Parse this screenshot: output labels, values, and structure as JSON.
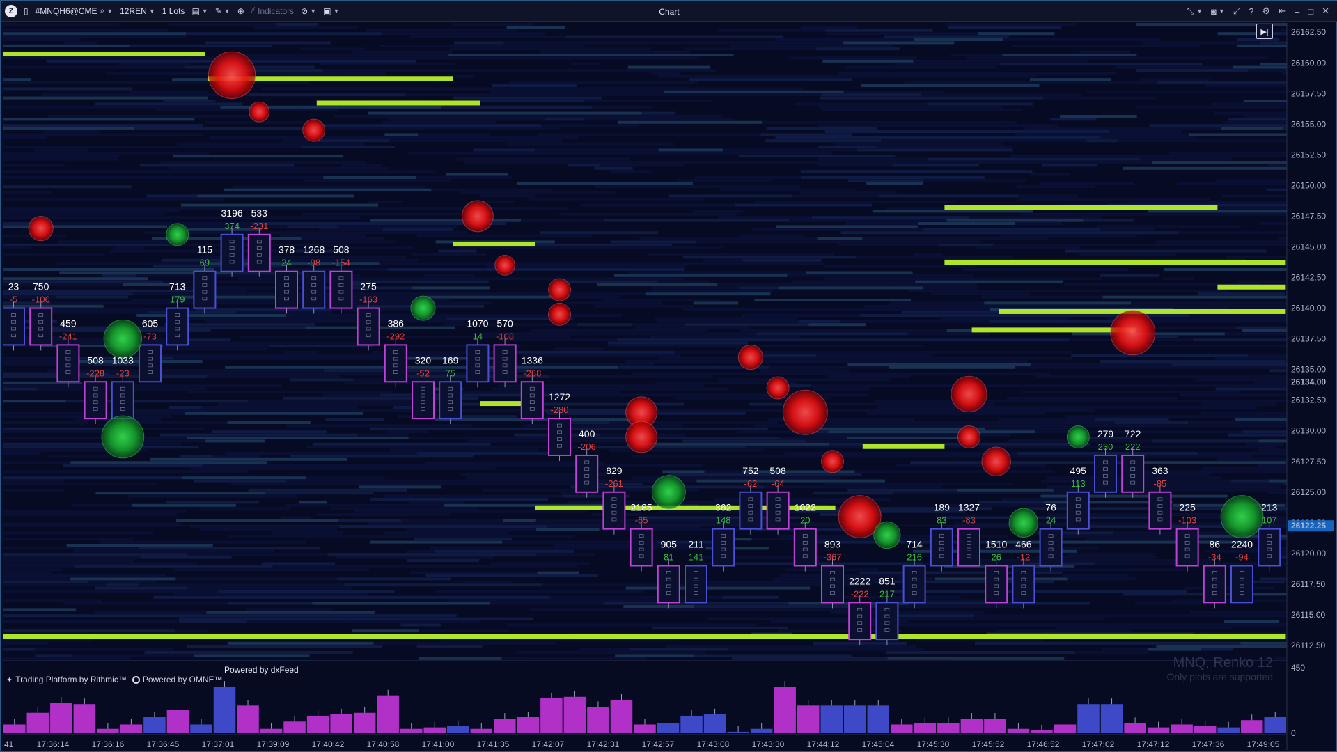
{
  "titlebar": {
    "symbol": "#MNQH6@CME",
    "bar_type": "12REN",
    "lots": "1 Lots",
    "indicators": "Indicators",
    "window_title": "Chart"
  },
  "price_axis": {
    "labels": [
      "26162.50",
      "26160.00",
      "26157.50",
      "26155.00",
      "26152.50",
      "26150.00",
      "26147.50",
      "26145.00",
      "26142.50",
      "26140.00",
      "26137.50",
      "26135.00",
      "26132.50",
      "26130.00",
      "26127.50",
      "26125.00",
      "26122.50",
      "26120.00",
      "26117.50",
      "26115.00",
      "26112.50"
    ],
    "last_price": "26134.00",
    "current_price": "26122.25",
    "volume_max": "450",
    "volume_zero": "0"
  },
  "time_axis": [
    "17:36:14",
    "17:36:16",
    "17:36:45",
    "17:37:01",
    "17:39:09",
    "17:40:42",
    "17:40:58",
    "17:41:00",
    "17:41:35",
    "17:42:07",
    "17:42:31",
    "17:42:57",
    "17:43:08",
    "17:43:30",
    "17:44:12",
    "17:45:04",
    "17:45:30",
    "17:45:52",
    "17:46:52",
    "17:47:02",
    "17:47:12",
    "17:47:36",
    "17:49:05"
  ],
  "time_axis_partial": "41",
  "overlay": {
    "platform_text": "Trading Platform by Rithmic™",
    "omne_text": "Powered by OMNE™",
    "dxfeed_text": "Powered by dxFeed",
    "watermark_title": "MNQ, Renko 12",
    "watermark_sub": "Only plots are supported"
  },
  "chart_data": {
    "type": "renko-footprint",
    "price_range": [
      26111.25,
      26163.25
    ],
    "bricks": [
      {
        "o": 26137.0,
        "c": 26140.0,
        "vol": "23",
        "delta": "-5",
        "d": "r"
      },
      {
        "o": 26140.0,
        "c": 26137.0,
        "vol": "750",
        "delta": "-106",
        "d": "r",
        "b": 26141.5
      },
      {
        "o": 26137.0,
        "c": 26134.0,
        "vol": "459",
        "delta": "-241",
        "d": "r"
      },
      {
        "o": 26134.0,
        "c": 26131.0,
        "vol": "508",
        "delta": "-228",
        "d": "r"
      },
      {
        "o": 26131.0,
        "c": 26134.0,
        "vol": "1033",
        "delta": "-23",
        "d": "g",
        "b": 26127.5
      },
      {
        "o": 26134.0,
        "c": 26137.0,
        "vol": "605",
        "delta": "-73",
        "d": "r"
      },
      {
        "o": 26137.0,
        "c": 26140.0,
        "vol": "713",
        "delta": "179",
        "d": "g",
        "b": 26140.0
      },
      {
        "o": 26140.0,
        "c": 26143.0,
        "vol": "115",
        "delta": "69",
        "d": "g"
      },
      {
        "o": 26143.0,
        "c": 26146.0,
        "vol": "3196",
        "delta": "374",
        "d": "g",
        "b": 26148.0
      },
      {
        "o": 26146.0,
        "c": 26143.0,
        "vol": "533",
        "delta": "-231",
        "d": "r"
      },
      {
        "o": 26143.0,
        "c": 26140.0,
        "vol": "378",
        "delta": "24",
        "d": "g"
      },
      {
        "o": 26140.0,
        "c": 26143.0,
        "vol": "1268",
        "delta": "-98",
        "d": "r",
        "b": 26144.0
      },
      {
        "o": 26143.0,
        "c": 26140.0,
        "vol": "508",
        "delta": "-154",
        "d": "r"
      },
      {
        "o": 26140.0,
        "c": 26137.0,
        "vol": "275",
        "delta": "-163",
        "d": "r"
      },
      {
        "o": 26137.0,
        "c": 26134.0,
        "vol": "386",
        "delta": "-292",
        "d": "r"
      },
      {
        "o": 26134.0,
        "c": 26131.0,
        "vol": "320",
        "delta": "-52",
        "d": "r",
        "b": 26131.0
      },
      {
        "o": 26131.0,
        "c": 26134.0,
        "vol": "169",
        "delta": "75",
        "d": "g"
      },
      {
        "o": 26134.0,
        "c": 26137.0,
        "vol": "1070",
        "delta": "14",
        "d": "g",
        "b": 26136.5
      },
      {
        "o": 26137.0,
        "c": 26134.0,
        "vol": "570",
        "delta": "-108",
        "d": "r"
      },
      {
        "o": 26134.0,
        "c": 26131.0,
        "vol": "1336",
        "delta": "-268",
        "d": "r"
      },
      {
        "o": 26131.0,
        "c": 26128.0,
        "vol": "1272",
        "delta": "-280",
        "d": "r",
        "b": 26130.0
      },
      {
        "o": 26128.0,
        "c": 26125.0,
        "vol": "400",
        "delta": "-206",
        "d": "r"
      },
      {
        "o": 26125.0,
        "c": 26122.0,
        "vol": "829",
        "delta": "-261",
        "d": "r"
      },
      {
        "o": 26122.0,
        "c": 26119.0,
        "vol": "2185",
        "delta": "-65",
        "d": "r",
        "b": 26120.5
      },
      {
        "o": 26119.0,
        "c": 26116.0,
        "vol": "905",
        "delta": "81",
        "d": "g",
        "b": 26114.5
      },
      {
        "o": 26116.0,
        "c": 26119.0,
        "vol": "211",
        "delta": "141",
        "d": "g"
      },
      {
        "o": 26119.0,
        "c": 26122.0,
        "vol": "362",
        "delta": "148",
        "d": "g"
      },
      {
        "o": 26122.0,
        "c": 26125.0,
        "vol": "752",
        "delta": "-62",
        "d": "r",
        "b": 26124.0
      },
      {
        "o": 26125.0,
        "c": 26122.0,
        "vol": "508",
        "delta": "-64",
        "d": "r"
      },
      {
        "o": 26122.0,
        "c": 26119.0,
        "vol": "1022",
        "delta": "20",
        "d": "g",
        "b": 26119.0
      },
      {
        "o": 26119.0,
        "c": 26116.0,
        "vol": "893",
        "delta": "-367",
        "d": "r"
      },
      {
        "o": 26116.0,
        "c": 26113.0,
        "vol": "2222",
        "delta": "-222",
        "d": "r",
        "b": 26112.0
      },
      {
        "o": 26113.0,
        "c": 26116.0,
        "vol": "851",
        "delta": "217",
        "d": "g"
      },
      {
        "o": 26116.0,
        "c": 26119.0,
        "vol": "714",
        "delta": "216",
        "d": "g"
      },
      {
        "o": 26119.0,
        "c": 26122.0,
        "vol": "189",
        "delta": "83",
        "d": "g"
      },
      {
        "o": 26122.0,
        "c": 26119.0,
        "vol": "1327",
        "delta": "-83",
        "d": "r",
        "b": 26122.5
      },
      {
        "o": 26119.0,
        "c": 26116.0,
        "vol": "1510",
        "delta": "26",
        "d": "g"
      },
      {
        "o": 26116.0,
        "c": 26119.0,
        "vol": "466",
        "delta": "-12",
        "d": "r"
      },
      {
        "o": 26119.0,
        "c": 26122.0,
        "vol": "76",
        "delta": "24",
        "d": "g"
      },
      {
        "o": 26122.0,
        "c": 26125.0,
        "vol": "495",
        "delta": "113",
        "d": "g"
      },
      {
        "o": 26125.0,
        "c": 26128.0,
        "vol": "279",
        "delta": "230",
        "d": "g"
      },
      {
        "o": 26128.0,
        "c": 26125.0,
        "vol": "722",
        "delta": "222",
        "d": "g",
        "b": 26128.0
      },
      {
        "o": 26125.0,
        "c": 26122.0,
        "vol": "363",
        "delta": "-85",
        "d": "r"
      },
      {
        "o": 26122.0,
        "c": 26119.0,
        "vol": "225",
        "delta": "-103",
        "d": "r"
      },
      {
        "o": 26119.0,
        "c": 26116.0,
        "vol": "86",
        "delta": "-34",
        "d": "r"
      },
      {
        "o": 26116.0,
        "c": 26119.0,
        "vol": "2240",
        "delta": "-94",
        "d": "r",
        "b": 26114.0
      },
      {
        "o": 26119.0,
        "c": 26122.0,
        "vol": "213",
        "delta": "107",
        "d": "g"
      }
    ],
    "bubbles": [
      {
        "i": 1,
        "p": 26146.5,
        "s": "r",
        "r": 0.6
      },
      {
        "i": 4,
        "p": 26129.5,
        "s": "g",
        "r": 1.4
      },
      {
        "i": 4,
        "p": 26137.5,
        "s": "g",
        "r": 1.2
      },
      {
        "i": 6,
        "p": 26146.0,
        "s": "g",
        "r": 0.5
      },
      {
        "i": 8,
        "p": 26159.0,
        "s": "r",
        "r": 1.6
      },
      {
        "i": 9,
        "p": 26156.0,
        "s": "r",
        "r": 0.4
      },
      {
        "i": 11,
        "p": 26154.5,
        "s": "r",
        "r": 0.5
      },
      {
        "i": 15,
        "p": 26140.0,
        "s": "g",
        "r": 0.6
      },
      {
        "i": 17,
        "p": 26147.5,
        "s": "r",
        "r": 0.9
      },
      {
        "i": 18,
        "p": 26143.5,
        "s": "r",
        "r": 0.4
      },
      {
        "i": 20,
        "p": 26141.5,
        "s": "r",
        "r": 0.5
      },
      {
        "i": 20,
        "p": 26139.5,
        "s": "r",
        "r": 0.5
      },
      {
        "i": 23,
        "p": 26131.5,
        "s": "r",
        "r": 0.9
      },
      {
        "i": 23,
        "p": 26129.5,
        "s": "r",
        "r": 0.9
      },
      {
        "i": 24,
        "p": 26125.0,
        "s": "g",
        "r": 1.0
      },
      {
        "i": 27,
        "p": 26136.0,
        "s": "r",
        "r": 0.6
      },
      {
        "i": 28,
        "p": 26133.5,
        "s": "r",
        "r": 0.5
      },
      {
        "i": 29,
        "p": 26131.5,
        "s": "r",
        "r": 1.5
      },
      {
        "i": 30,
        "p": 26127.5,
        "s": "r",
        "r": 0.5
      },
      {
        "i": 31,
        "p": 26123.0,
        "s": "r",
        "r": 1.4
      },
      {
        "i": 32,
        "p": 26121.5,
        "s": "g",
        "r": 0.7
      },
      {
        "i": 35,
        "p": 26133.0,
        "s": "r",
        "r": 1.1
      },
      {
        "i": 35,
        "p": 26129.5,
        "s": "r",
        "r": 0.5
      },
      {
        "i": 36,
        "p": 26127.5,
        "s": "r",
        "r": 0.8
      },
      {
        "i": 37,
        "p": 26122.5,
        "s": "g",
        "r": 0.8
      },
      {
        "i": 39,
        "p": 26129.5,
        "s": "g",
        "r": 0.5
      },
      {
        "i": 41,
        "p": 26138.0,
        "s": "r",
        "r": 1.5
      },
      {
        "i": 45,
        "p": 26123.0,
        "s": "g",
        "r": 1.4
      }
    ],
    "liquidity_lines": [
      {
        "from": -0.1,
        "to": 7.4,
        "p": 26160.75
      },
      {
        "from": 7.5,
        "to": 16.5,
        "p": 26158.75
      },
      {
        "from": 11.5,
        "to": 17.5,
        "p": 26156.75
      },
      {
        "from": 16.5,
        "to": 19.5,
        "p": 26145.25
      },
      {
        "from": 34.5,
        "to": 44.5,
        "p": 26148.25
      },
      {
        "from": 34.5,
        "to": 47.0,
        "p": 26143.75
      },
      {
        "from": 44.5,
        "to": 47.0,
        "p": 26141.75
      },
      {
        "from": 36.5,
        "to": 47.0,
        "p": 26139.75
      },
      {
        "from": 35.5,
        "to": 41.5,
        "p": 26138.25
      },
      {
        "from": 17.5,
        "to": 19.5,
        "p": 26132.25
      },
      {
        "from": 31.5,
        "to": 34.5,
        "p": 26128.75
      },
      {
        "from": 19.5,
        "to": 30.5,
        "p": 26123.75
      },
      {
        "from": -0.1,
        "to": 47.0,
        "p": 26113.25
      }
    ],
    "volume_bars": [
      {
        "v": 60,
        "c": "m"
      },
      {
        "v": 140,
        "c": "m"
      },
      {
        "v": 210,
        "c": "m"
      },
      {
        "v": 200,
        "c": "m"
      },
      {
        "v": 30,
        "c": "m"
      },
      {
        "v": 60,
        "c": "m"
      },
      {
        "v": 110,
        "c": "b"
      },
      {
        "v": 160,
        "c": "m"
      },
      {
        "v": 60,
        "c": "b"
      },
      {
        "v": 320,
        "c": "b"
      },
      {
        "v": 190,
        "c": "m"
      },
      {
        "v": 30,
        "c": "m"
      },
      {
        "v": 80,
        "c": "m"
      },
      {
        "v": 120,
        "c": "m"
      },
      {
        "v": 130,
        "c": "m"
      },
      {
        "v": 140,
        "c": "m"
      },
      {
        "v": 260,
        "c": "m"
      },
      {
        "v": 30,
        "c": "m"
      },
      {
        "v": 40,
        "c": "m"
      },
      {
        "v": 50,
        "c": "b"
      },
      {
        "v": 30,
        "c": "m"
      },
      {
        "v": 100,
        "c": "m"
      },
      {
        "v": 110,
        "c": "m"
      },
      {
        "v": 240,
        "c": "m"
      },
      {
        "v": 250,
        "c": "m"
      },
      {
        "v": 180,
        "c": "m"
      },
      {
        "v": 230,
        "c": "m"
      },
      {
        "v": 60,
        "c": "m"
      },
      {
        "v": 70,
        "c": "b"
      },
      {
        "v": 120,
        "c": "b"
      },
      {
        "v": 130,
        "c": "b"
      },
      {
        "v": 10,
        "c": "b"
      },
      {
        "v": 30,
        "c": "b"
      },
      {
        "v": 320,
        "c": "m"
      },
      {
        "v": 190,
        "c": "m"
      },
      {
        "v": 190,
        "c": "b"
      },
      {
        "v": 190,
        "c": "b"
      },
      {
        "v": 190,
        "c": "b"
      },
      {
        "v": 60,
        "c": "m"
      },
      {
        "v": 70,
        "c": "m"
      },
      {
        "v": 70,
        "c": "m"
      },
      {
        "v": 100,
        "c": "m"
      },
      {
        "v": 100,
        "c": "m"
      },
      {
        "v": 30,
        "c": "m"
      },
      {
        "v": 20,
        "c": "m"
      },
      {
        "v": 60,
        "c": "m"
      },
      {
        "v": 200,
        "c": "b"
      },
      {
        "v": 200,
        "c": "b"
      },
      {
        "v": 70,
        "c": "m"
      },
      {
        "v": 40,
        "c": "m"
      },
      {
        "v": 60,
        "c": "m"
      },
      {
        "v": 50,
        "c": "m"
      },
      {
        "v": 40,
        "c": "b"
      },
      {
        "v": 90,
        "c": "m"
      },
      {
        "v": 110,
        "c": "b"
      }
    ],
    "volume_ylim": [
      0,
      450
    ]
  },
  "colors": {
    "background": "#070b22",
    "up_brick": "#4a4fd6",
    "down_brick": "#c040d8",
    "liquidity": "#b8f02a",
    "bubble_sell": "#ff1a1a",
    "bubble_buy": "#1fc43a",
    "volume_magenta": "#b030c8",
    "volume_blue": "#3e49c8",
    "vol_label": "#ffffff",
    "delta_pos": "#3dbd3d",
    "delta_neg": "#e04040",
    "price_highlight": "#1565c0"
  },
  "icons": {
    "logo": "app-logo",
    "search": "search-icon",
    "camera": "camera-icon",
    "settings": "gear-icon"
  }
}
